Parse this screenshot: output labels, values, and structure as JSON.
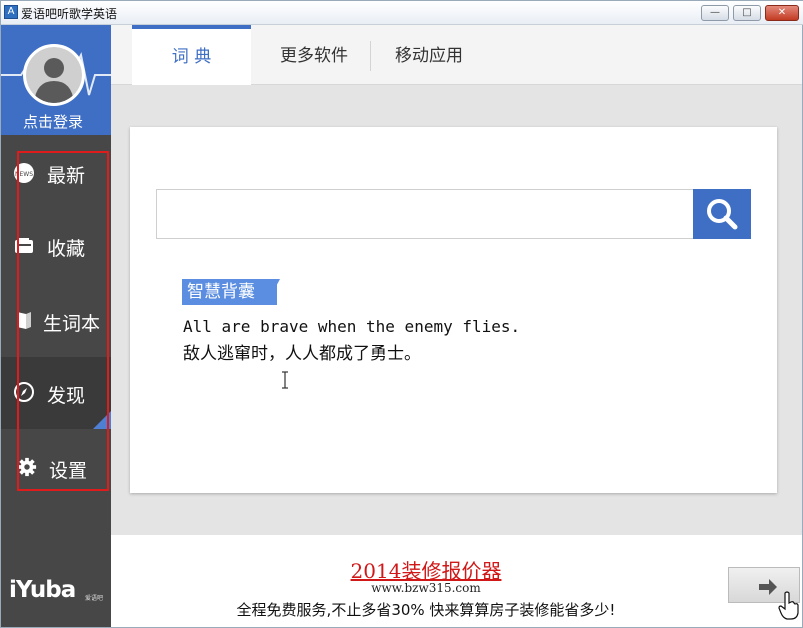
{
  "window": {
    "title": "爱语吧听歌学英语",
    "app_icon_text": "A",
    "controls": {
      "minimize": "—",
      "maximize": "□",
      "close": "✕"
    }
  },
  "sidebar": {
    "login_label": "点击登录",
    "items": [
      {
        "label": "最新",
        "icon": "news-icon"
      },
      {
        "label": "收藏",
        "icon": "favorites-icon"
      },
      {
        "label": "生词本",
        "icon": "vocabulary-book-icon"
      },
      {
        "label": "发现",
        "icon": "compass-icon",
        "active": true
      },
      {
        "label": "设置",
        "icon": "gear-icon"
      }
    ],
    "logo_text": "iYuba",
    "logo_sub": "爱语吧"
  },
  "tabs": [
    {
      "label": "词  典",
      "active": true
    },
    {
      "label": "更多软件"
    },
    {
      "label": "移动应用"
    }
  ],
  "search": {
    "value": "",
    "placeholder": ""
  },
  "tip": {
    "tag": "智慧背囊",
    "english": "All are brave when the enemy flies.",
    "chinese": "敌人逃窜时，人人都成了勇士。"
  },
  "ad": {
    "title": "2014装修报价器",
    "url": "www.bzw315.com",
    "text": "全程免费服务,不止多省30% 快来算算房子装修能省多少!",
    "next_icon": "arrow-right-icon"
  },
  "colors": {
    "accent": "#3f6fc4",
    "sidebar": "#474747",
    "highlight_box": "#e01b1b",
    "ad_title": "#d01818"
  }
}
